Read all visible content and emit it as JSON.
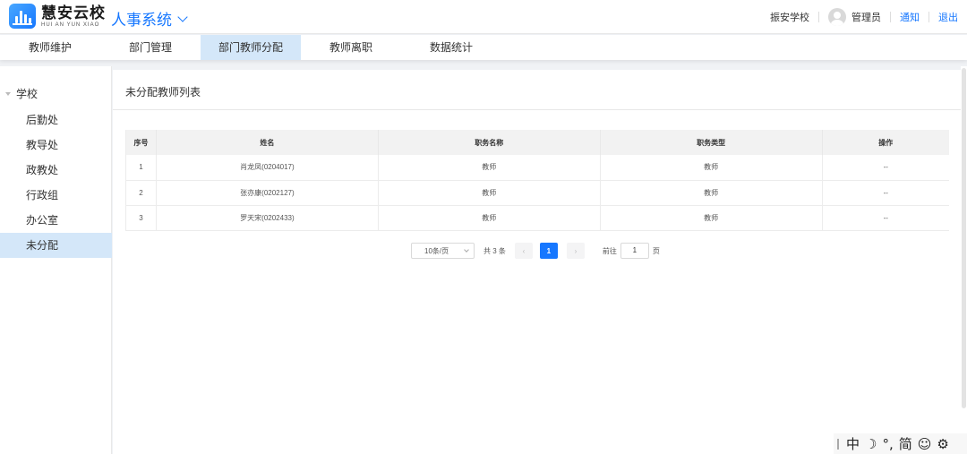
{
  "header": {
    "logo_cn": "慧安云校",
    "logo_en": "HUI AN YUN XIAO",
    "system_title": "人事系统",
    "school": "振安学校",
    "user": "管理员",
    "notify": "通知",
    "logout": "退出"
  },
  "tabs": [
    {
      "label": "教师维护"
    },
    {
      "label": "部门管理"
    },
    {
      "label": "部门教师分配"
    },
    {
      "label": "教师离职"
    },
    {
      "label": "数据统计"
    }
  ],
  "sidebar": {
    "root": "学校",
    "items": [
      {
        "label": "后勤处"
      },
      {
        "label": "教导处"
      },
      {
        "label": "政教处"
      },
      {
        "label": "行政组"
      },
      {
        "label": "办公室"
      },
      {
        "label": "未分配"
      }
    ]
  },
  "main": {
    "title": "未分配教师列表",
    "columns": [
      "序号",
      "姓名",
      "职务名称",
      "职务类型",
      "操作"
    ],
    "rows": [
      {
        "no": "1",
        "name": "肖龙凤(0204017)",
        "title": "教师",
        "type": "教师",
        "op": "--"
      },
      {
        "no": "2",
        "name": "张亦康(0202127)",
        "title": "教师",
        "type": "教师",
        "op": "--"
      },
      {
        "no": "3",
        "name": "罗天宋(0202433)",
        "title": "教师",
        "type": "教师",
        "op": "--"
      }
    ]
  },
  "pager": {
    "page_size": "10条/页",
    "total": "共 3 条",
    "prev": "‹",
    "current": "1",
    "next": "›",
    "goto_label": "前往",
    "goto_value": "1",
    "page_unit": "页"
  },
  "ime": {
    "mode": "中",
    "moon": "☽",
    "punct": "°,",
    "script": "简",
    "emoji": "☺",
    "settings": "⚙"
  }
}
